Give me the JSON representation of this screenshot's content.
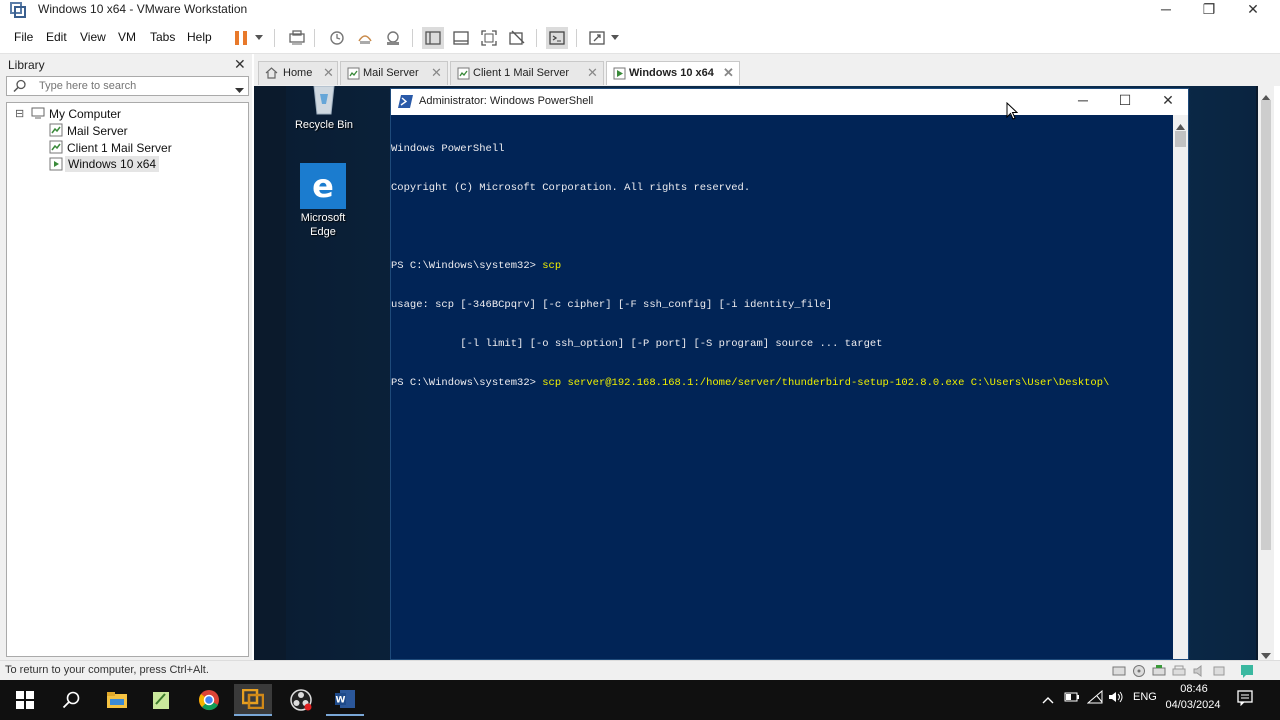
{
  "window": {
    "title": "Windows 10 x64 - VMware Workstation",
    "min_label": "─",
    "restore_label": "❐",
    "close_label": "✕"
  },
  "menu": {
    "items": [
      "File",
      "Edit",
      "View",
      "VM",
      "Tabs",
      "Help"
    ]
  },
  "library": {
    "title": "Library",
    "close_label": "✕",
    "search_placeholder": "Type here to search",
    "tree": {
      "root_expander": "⊟",
      "root": "My Computer",
      "children": [
        "Mail Server",
        "Client 1  Mail Server",
        "Windows 10 x64"
      ]
    }
  },
  "tabs": [
    {
      "label": "Home",
      "close": "✕"
    },
    {
      "label": "Mail Server",
      "close": "✕"
    },
    {
      "label": "Client 1  Mail Server",
      "close": "✕"
    },
    {
      "label": "Windows 10 x64",
      "close": "✕"
    }
  ],
  "guest_desktop": {
    "icons": [
      {
        "label": "Recycle Bin"
      },
      {
        "label": "Microsoft Edge",
        "line1": "Microsoft",
        "line2": "Edge"
      }
    ]
  },
  "powershell": {
    "title": "Administrator: Windows PowerShell",
    "controls": {
      "minimize": "─",
      "maximize": "☐",
      "close": "✕"
    },
    "lines": [
      {
        "text": "Windows PowerShell"
      },
      {
        "text": "Copyright (C) Microsoft Corporation. All rights reserved."
      },
      {
        "text": ""
      },
      {
        "prompt": "PS C:\\Windows\\system32> ",
        "cmd": "scp"
      },
      {
        "text": "usage: scp [-346BCpqrv] [-c cipher] [-F ssh_config] [-i identity_file]"
      },
      {
        "text": "           [-l limit] [-o ssh_option] [-P port] [-S program] source ... target"
      },
      {
        "prompt": "PS C:\\Windows\\system32> ",
        "cmd": "scp",
        "args": " server@192.168.168.1:/home/server/thunderbird-setup-102.8.0.exe C:\\Users\\User\\Desktop\\"
      }
    ]
  },
  "statusbar": {
    "text": "To return to your computer, press Ctrl+Alt."
  },
  "taskbar": {
    "language": "ENG",
    "time": "08:46",
    "date": "04/03/2024"
  },
  "colors": {
    "ps_bg": "#012456",
    "ps_text": "#eeedf0",
    "ps_cmd": "#f0f000",
    "pause_orange": "#e8792a"
  }
}
